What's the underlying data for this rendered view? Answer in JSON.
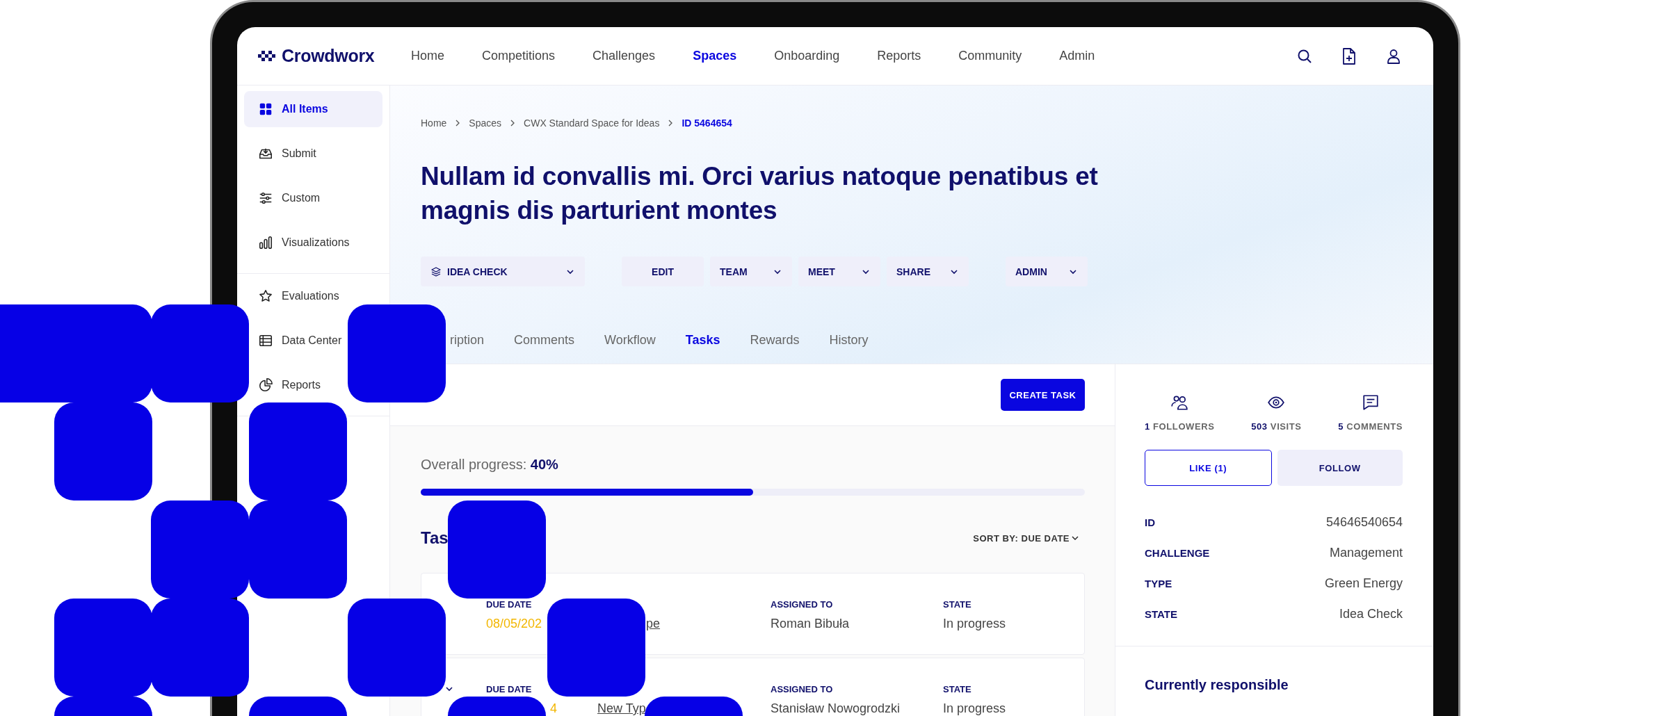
{
  "brand": {
    "name": "Crowdworx"
  },
  "nav": [
    {
      "label": "Home",
      "selected": false
    },
    {
      "label": "Competitions",
      "selected": false
    },
    {
      "label": "Challenges",
      "selected": false
    },
    {
      "label": "Spaces",
      "selected": true
    },
    {
      "label": "Onboarding",
      "selected": false
    },
    {
      "label": "Reports",
      "selected": false
    },
    {
      "label": "Community",
      "selected": false
    },
    {
      "label": "Admin",
      "selected": false
    }
  ],
  "sidebar": {
    "groups": [
      [
        {
          "label": "All Items",
          "selected": true
        },
        {
          "label": "Submit",
          "selected": false
        },
        {
          "label": "Custom",
          "selected": false
        },
        {
          "label": "Visualizations",
          "selected": false
        }
      ],
      [
        {
          "label": "Evaluations",
          "selected": false
        },
        {
          "label": "Data Center",
          "selected": false
        },
        {
          "label": "Reports",
          "selected": false
        }
      ]
    ]
  },
  "breadcrumb": [
    {
      "label": "Home",
      "current": false
    },
    {
      "label": "Spaces",
      "current": false
    },
    {
      "label": "CWX Standard Space for Ideas",
      "current": false
    },
    {
      "label": "ID 5464654",
      "current": true
    }
  ],
  "title": "Nullam id convallis mi. Orci varius natoque penatibus et magnis dis parturient montes",
  "actions": [
    [
      {
        "label": "IDEA CHECK",
        "kind": "status"
      }
    ],
    [
      {
        "label": "EDIT",
        "kind": "button"
      },
      {
        "label": "TEAM",
        "kind": "dropdown"
      },
      {
        "label": "MEET",
        "kind": "dropdown"
      },
      {
        "label": "SHARE",
        "kind": "dropdown"
      }
    ],
    [
      {
        "label": "ADMIN",
        "kind": "dropdown"
      }
    ]
  ],
  "tabs": [
    {
      "label": "ription",
      "selected": false
    },
    {
      "label": "Comments",
      "selected": false
    },
    {
      "label": "Workflow",
      "selected": false
    },
    {
      "label": "Tasks",
      "selected": true
    },
    {
      "label": "Rewards",
      "selected": false
    },
    {
      "label": "History",
      "selected": false
    }
  ],
  "create_button": "CREATE TASK",
  "progress": {
    "label": "Overall progress:",
    "value": "40%",
    "level": 0.5
  },
  "tasks": {
    "title": "Tas",
    "sort": "SORT BY: DUE DATE",
    "rows": [
      {
        "cells": [
          {
            "header": "DUE DATE",
            "value": "08/05/202"
          },
          {
            "value": "pe"
          },
          {
            "header": "ASSIGNED TO",
            "value": "Roman Bibuła"
          },
          {
            "header": "STATE",
            "value": "In progress"
          }
        ]
      },
      {
        "toggle": true,
        "cells": [
          {
            "header": "DUE DATE",
            "value": "4"
          },
          {
            "value": "New Typ"
          },
          {
            "header": "ASSIGNED TO",
            "value": "Stanisław Nowogrodzki"
          },
          {
            "header": "STATE",
            "value": "In progress"
          }
        ]
      }
    ]
  },
  "stats": [
    {
      "count": "1",
      "label": "FOLLOWERS"
    },
    {
      "count": "503",
      "label": "VISITS"
    },
    {
      "count": "5",
      "label": "COMMENTS"
    }
  ],
  "panel_buttons": [
    {
      "label": "LIKE (1)",
      "kind": "outline"
    },
    {
      "label": "FOLLOW",
      "kind": "soft"
    }
  ],
  "details": [
    {
      "label": "ID",
      "value": "54646540654"
    },
    {
      "label": "CHALLENGE",
      "value": "Management"
    },
    {
      "label": "TYPE",
      "value": "Green Energy"
    },
    {
      "label": "STATE",
      "value": "Idea Check"
    }
  ],
  "responsible_title": "Currently responsible"
}
